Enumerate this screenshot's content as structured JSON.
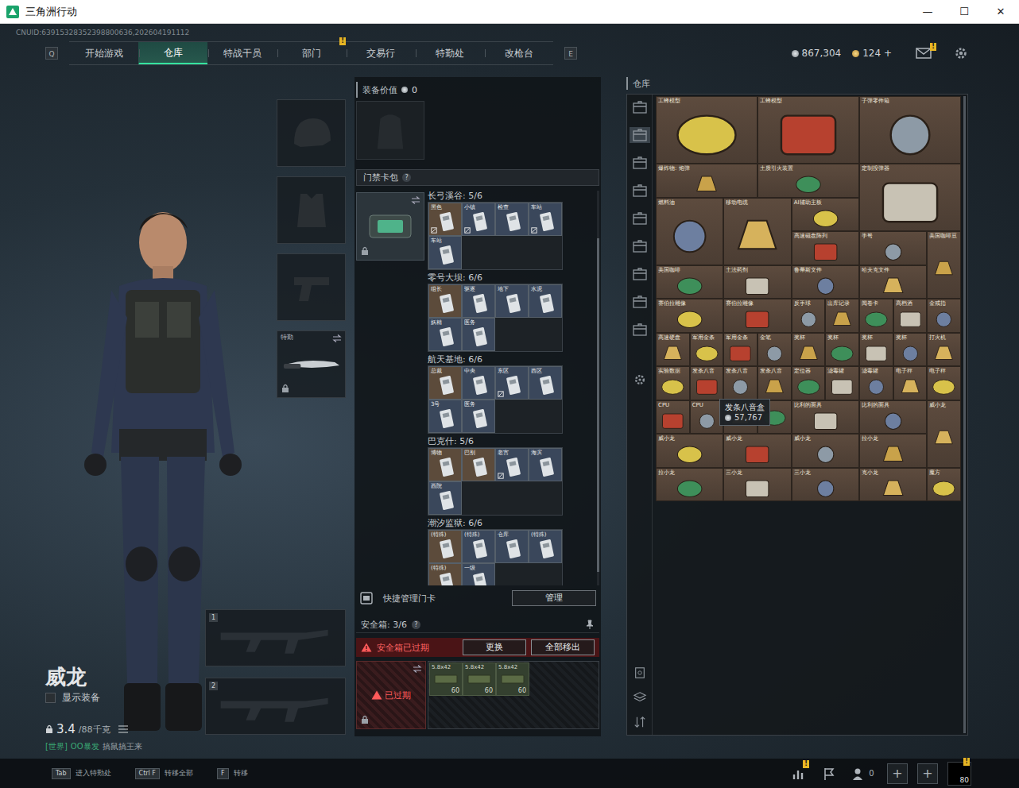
{
  "window": {
    "title": "三角洲行动",
    "controls": [
      "—",
      "☐",
      "✕"
    ]
  },
  "uid": "CNUID:63915328352398800636,202604191112",
  "nav": {
    "prev_key": "Q",
    "next_key": "E",
    "tabs": [
      {
        "label": "开始游戏",
        "selected": false,
        "badge": ""
      },
      {
        "label": "仓库",
        "selected": true,
        "badge": ""
      },
      {
        "label": "特战干员",
        "selected": false,
        "badge": ""
      },
      {
        "label": "部门",
        "selected": false,
        "badge": "!"
      },
      {
        "label": "交易行",
        "selected": false,
        "badge": ""
      },
      {
        "label": "特勤处",
        "selected": false,
        "badge": ""
      },
      {
        "label": "改枪台",
        "selected": false,
        "badge": ""
      }
    ]
  },
  "wallet": [
    {
      "kind": "silver",
      "amount": "867,304"
    },
    {
      "kind": "gold",
      "amount": "124 +"
    }
  ],
  "mail": {
    "badge": "!"
  },
  "character": {
    "name": "威龙",
    "show_equipment": {
      "label": "显示装备",
      "checked": false
    },
    "weight": "3.4",
    "weight_max": "/88千克",
    "chat": {
      "channel": "[世界]",
      "sender": "OO暴发",
      "message": "搞鼠搞王来"
    }
  },
  "slots": [
    {
      "kind": "helmet",
      "label": "",
      "locked": false,
      "swap": false
    },
    {
      "kind": "armor",
      "label": "",
      "locked": false,
      "swap": false
    },
    {
      "kind": "pistol",
      "label": "",
      "locked": false,
      "swap": false
    },
    {
      "kind": "melee",
      "label": "特勤",
      "locked": true,
      "swap": true
    }
  ],
  "weapons": [
    {
      "number": "1"
    },
    {
      "number": "2"
    }
  ],
  "equipment_value": {
    "label": "装备价值",
    "value": "0"
  },
  "keycard_case": {
    "title": "门禁卡包",
    "help": "?",
    "locked": true,
    "swap": true,
    "maps": [
      {
        "title": "长弓溪谷: 5/6",
        "cards": [
          {
            "label": "黑色",
            "color": "#5c4b3b",
            "marked": true
          },
          {
            "label": "小镇",
            "color": "#3a475b",
            "marked": true
          },
          {
            "label": "检查",
            "color": "#3a475b",
            "marked": false
          },
          {
            "label": "车站",
            "color": "#3a475b",
            "marked": true
          },
          {
            "label": "车站",
            "color": "#3a475b",
            "marked": false
          }
        ]
      },
      {
        "title": "零号大坝: 6/6",
        "cards": [
          {
            "label": "组长",
            "color": "#5c4b3b",
            "marked": false
          },
          {
            "label": "驱逐",
            "color": "#3a475b",
            "marked": false
          },
          {
            "label": "地下",
            "color": "#3a475b",
            "marked": false
          },
          {
            "label": "水泥",
            "color": "#3a475b",
            "marked": false
          },
          {
            "label": "妖精",
            "color": "#3a475b",
            "marked": false
          },
          {
            "label": "医务",
            "color": "#3a475b",
            "marked": false
          }
        ]
      },
      {
        "title": "航天基地: 6/6",
        "cards": [
          {
            "label": "总裁",
            "color": "#5c4b3b",
            "marked": false
          },
          {
            "label": "中央",
            "color": "#3a475b",
            "marked": false
          },
          {
            "label": "东区",
            "color": "#3a475b",
            "marked": true
          },
          {
            "label": "西区",
            "color": "#3a475b",
            "marked": false
          },
          {
            "label": "3号",
            "color": "#3a475b",
            "marked": false
          },
          {
            "label": "医务",
            "color": "#3a475b",
            "marked": false
          }
        ]
      },
      {
        "title": "巴克什: 5/6",
        "cards": [
          {
            "label": "博物",
            "color": "#5c4b3b",
            "marked": false
          },
          {
            "label": "巴别",
            "color": "#5c4b3b",
            "marked": false
          },
          {
            "label": "老宫",
            "color": "#3a475b",
            "marked": true
          },
          {
            "label": "海滨",
            "color": "#3a475b",
            "marked": false
          },
          {
            "label": "西院",
            "color": "#3a475b",
            "marked": false
          }
        ]
      },
      {
        "title": "潮汐监狱: 6/6",
        "cards": [
          {
            "label": "(特殊)",
            "color": "#5c4b3b",
            "marked": false
          },
          {
            "label": "(特殊)",
            "color": "#3a475b",
            "marked": false
          },
          {
            "label": "仓库",
            "color": "#3a475b",
            "marked": false
          },
          {
            "label": "(特殊)",
            "color": "#3a475b",
            "marked": false
          },
          {
            "label": "(特殊)",
            "color": "#5c4b3b",
            "marked": false
          },
          {
            "label": "一级",
            "color": "#3a475b",
            "marked": false
          }
        ]
      }
    ]
  },
  "quick_manage": {
    "label": "快捷管理门卡",
    "button": "管理"
  },
  "safe_box": {
    "title": "安全箱: 3/6",
    "help": "?",
    "warning": "安全箱已过期",
    "buttons": [
      {
        "label": "更换"
      },
      {
        "label": "全部移出"
      }
    ],
    "status": "已过期",
    "locked": true,
    "items": [
      {
        "name": "5.8x42",
        "count": "60"
      },
      {
        "name": "5.8x42",
        "count": "60"
      },
      {
        "name": "5.8x42",
        "count": "60"
      }
    ]
  },
  "warehouse": {
    "title": "仓库",
    "sidebar": [
      {
        "selected": false
      },
      {
        "selected": true
      },
      {
        "selected": false
      },
      {
        "selected": false
      },
      {
        "selected": false
      },
      {
        "selected": false
      },
      {
        "selected": false
      },
      {
        "selected": false
      },
      {
        "selected": false
      }
    ],
    "items": [
      {
        "name": "工蜂模型",
        "kind": "w3h2"
      },
      {
        "name": "工蜂模型",
        "kind": "w3h2"
      },
      {
        "name": "子弹零件箱",
        "kind": "w3h2"
      },
      {
        "name": "爆炸物: 炮弹",
        "kind": "w3h1"
      },
      {
        "name": "土质引火装置",
        "kind": "w3h1"
      },
      {
        "name": "定制投弹器",
        "kind": "w3h2"
      },
      {
        "name": "燃料油",
        "kind": "w2h2"
      },
      {
        "name": "移动电缆",
        "kind": "w2h2"
      },
      {
        "name": "AI辅助主板",
        "kind": "w2h1"
      },
      {
        "name": "高速磁盘阵列",
        "kind": "w2h1"
      },
      {
        "name": "手弩",
        "kind": "w2h1"
      },
      {
        "name": "美国咖啡豆",
        "kind": "w1h2"
      },
      {
        "name": "美国咖啡",
        "kind": "w2h1"
      },
      {
        "name": "土法药剂",
        "kind": "w2h1"
      },
      {
        "name": "鲁蒂斯文件",
        "kind": "w2h1"
      },
      {
        "name": "哈夫克文件",
        "kind": "w2h1"
      },
      {
        "name": "赛伯拉雕像",
        "kind": "w2h1"
      },
      {
        "name": "赛伯拉雕像",
        "kind": "w2h1"
      },
      {
        "name": "反手球",
        "kind": "w1h1"
      },
      {
        "name": "出库记录",
        "kind": "w1h1"
      },
      {
        "name": "阅卷卡",
        "kind": "w1h1"
      },
      {
        "name": "高档酒",
        "kind": "w1h1"
      },
      {
        "name": "金戒指",
        "kind": "w1h1"
      },
      {
        "name": "高速硬盘",
        "kind": "w1h1"
      },
      {
        "name": "军用金条",
        "kind": "w1h1"
      },
      {
        "name": "军用金条",
        "kind": "w1h1"
      },
      {
        "name": "金笔",
        "kind": "w1h1"
      },
      {
        "name": "奖杯",
        "kind": "w1h1"
      },
      {
        "name": "奖杯",
        "kind": "w1h1"
      },
      {
        "name": "奖杯",
        "kind": "w1h1"
      },
      {
        "name": "奖杯",
        "kind": "w1h1"
      },
      {
        "name": "打火机",
        "kind": "w1h1"
      },
      {
        "name": "实验数据",
        "kind": "w1h1"
      },
      {
        "name": "发条八音",
        "kind": "w1h1"
      },
      {
        "name": "发条八音",
        "kind": "w1h1"
      },
      {
        "name": "发条八音",
        "kind": "w1h1"
      },
      {
        "name": "定位器",
        "kind": "w1h1"
      },
      {
        "name": "滤毒罐",
        "kind": "w1h1"
      },
      {
        "name": "滤毒罐",
        "kind": "w1h1"
      },
      {
        "name": "电子秤",
        "kind": "w1h1"
      },
      {
        "name": "电子秤",
        "kind": "w1h1"
      },
      {
        "name": "CPU",
        "kind": "w1h1"
      },
      {
        "name": "CPU",
        "kind": "w1h1"
      },
      {
        "name": "",
        "kind": "w1h1"
      },
      {
        "name": "",
        "kind": "w1h1"
      },
      {
        "name": "比利的面具",
        "kind": "w2h1"
      },
      {
        "name": "比利的面具",
        "kind": "w2h1"
      },
      {
        "name": "威小龙",
        "kind": "w1h2"
      },
      {
        "name": "威小龙",
        "kind": "w2h1"
      },
      {
        "name": "威小龙",
        "kind": "w2h1"
      },
      {
        "name": "威小龙",
        "kind": "w2h1"
      },
      {
        "name": "拉小龙",
        "kind": "w2h1"
      },
      {
        "name": "拉小龙",
        "kind": "w2h1"
      },
      {
        "name": "三小龙",
        "kind": "w2h1"
      },
      {
        "name": "三小龙",
        "kind": "w2h1"
      },
      {
        "name": "克小龙",
        "kind": "w2h1"
      },
      {
        "name": "魔方",
        "kind": "w1h1"
      }
    ],
    "tooltip": {
      "name": "发条八音盒",
      "price": "57,767"
    }
  },
  "hints": [
    {
      "key": "Tab",
      "label": "进入特勤处"
    },
    {
      "key": "Ctrl F",
      "label": "转移全部"
    },
    {
      "key": "F",
      "label": "转移"
    }
  ],
  "status": {
    "stats_badge": "!",
    "team_count": "0",
    "invites": [
      "+",
      "+"
    ],
    "level": "80",
    "profile_badge": "!"
  }
}
